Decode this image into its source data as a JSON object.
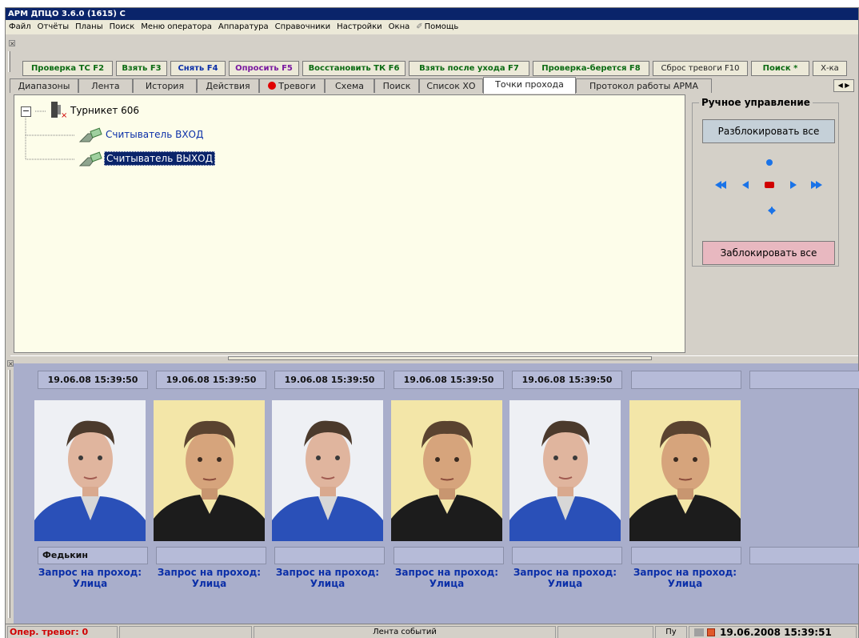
{
  "title": "АРМ ДПЦО  3.6.0 (1615) С",
  "menu": [
    "Файл",
    "Отчёты",
    "Планы",
    "Поиск",
    "Меню оператора",
    "Аппаратура",
    "Справочники",
    "Настройки",
    "Окна",
    "Помощь"
  ],
  "toolbar": [
    {
      "label": "Проверка ТС F2",
      "color": "#0b6b12"
    },
    {
      "label": "Взять F3",
      "color": "#0b6b12"
    },
    {
      "label": "Снять F4",
      "color": "#0b2fa8"
    },
    {
      "label": "Опросить F5",
      "color": "#7a1aa0"
    },
    {
      "label": "Восстановить ТК F6",
      "color": "#0b6b12"
    },
    {
      "label": "Взять после ухода F7",
      "color": "#0b6b12"
    },
    {
      "label": "Проверка-берется F8",
      "color": "#0b6b12"
    },
    {
      "label": "Сброс тревоги F10",
      "color": "#222222"
    },
    {
      "label": "Поиск *",
      "color": "#0b6b12"
    },
    {
      "label": "Х-ка",
      "color": "#222222"
    }
  ],
  "tabs": [
    "Диапазоны",
    "Лента",
    "История",
    "Действия",
    "Тревоги",
    "Схема",
    "Поиск",
    "Список ХО",
    "Точки прохода",
    "Протокол работы АРМА"
  ],
  "active_tab": "Точки прохода",
  "tree": {
    "root": "Турникет 606",
    "children": [
      "Считыватель ВХОД",
      "Считыватель ВЫХОД"
    ],
    "selected": "Считыватель ВЫХОД"
  },
  "manual": {
    "title": "Ручное управление",
    "unlock_all": "Разблокировать все",
    "lock_all": "Заблокировать все"
  },
  "cards": [
    {
      "time": "19.06.08 15:39:50",
      "name": "Федькин",
      "req1": "Запрос на проход:",
      "req2": "Улица",
      "person": "a"
    },
    {
      "time": "19.06.08 15:39:50",
      "name": "",
      "req1": "Запрос на проход:",
      "req2": "Улица",
      "person": "b"
    },
    {
      "time": "19.06.08 15:39:50",
      "name": "",
      "req1": "Запрос на проход:",
      "req2": "Улица",
      "person": "a"
    },
    {
      "time": "19.06.08 15:39:50",
      "name": "",
      "req1": "Запрос на проход:",
      "req2": "Улица",
      "person": "b"
    },
    {
      "time": "19.06.08 15:39:50",
      "name": "",
      "req1": "Запрос на проход:",
      "req2": "Улица",
      "person": "a"
    },
    {
      "time": "",
      "name": "",
      "req1": "Запрос на проход:",
      "req2": "Улица",
      "person": "b"
    },
    {
      "time": "",
      "name": "",
      "req1": "",
      "req2": "",
      "person": ""
    }
  ],
  "status": {
    "alarms": "Опер. тревог: 0",
    "feed": "Лента событий",
    "pu": "Пу",
    "datetime": "19.06.2008 15:39:51"
  }
}
